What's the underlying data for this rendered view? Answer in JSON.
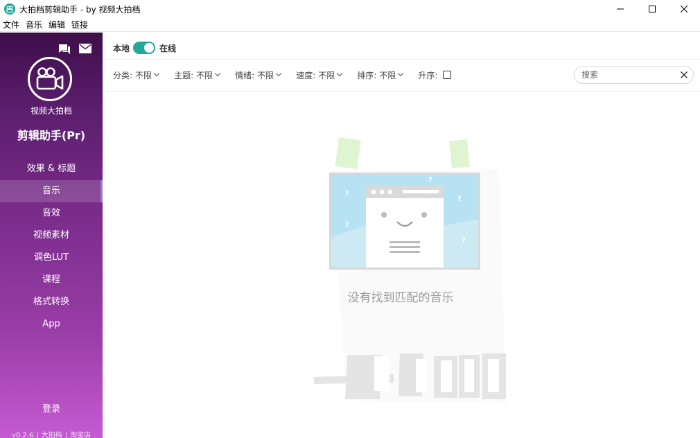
{
  "window": {
    "title": "大拍档剪辑助手 - by 视频大拍档",
    "controls": {
      "minimize_icon": "minimize-icon",
      "maximize_icon": "maximize-icon",
      "close_icon": "close-icon"
    }
  },
  "menu": [
    "文件",
    "音乐",
    "编辑",
    "链接"
  ],
  "sidebar": {
    "brand": "视频大拍档",
    "app_name": "剪辑助手(Pr)",
    "items": [
      {
        "label": "效果 & 标题",
        "active": false
      },
      {
        "label": "音乐",
        "active": true
      },
      {
        "label": "音效",
        "active": false
      },
      {
        "label": "视频素材",
        "active": false
      },
      {
        "label": "调色LUT",
        "active": false
      },
      {
        "label": "课程",
        "active": false
      },
      {
        "label": "格式转换",
        "active": false
      },
      {
        "label": "App",
        "active": false
      }
    ],
    "login": "登录",
    "footer": {
      "version": "v0.2.6",
      "sep": "|",
      "link1": "大拍档",
      "link2": "淘宝店"
    }
  },
  "main": {
    "source": {
      "local": "本地",
      "online": "在线",
      "toggle_on": true
    },
    "filters": [
      {
        "label": "分类:",
        "value": "不限"
      },
      {
        "label": "主题:",
        "value": "不限"
      },
      {
        "label": "情绪:",
        "value": "不限"
      },
      {
        "label": "速度:",
        "value": "不限"
      },
      {
        "label": "排序:",
        "value": "不限"
      }
    ],
    "ascending_label": "升序:",
    "ascending_checked": false,
    "search": {
      "placeholder": "搜索",
      "value": ""
    },
    "empty_message": "没有找到匹配的音乐"
  },
  "colors": {
    "accent": "#26a69a",
    "sidebar_top": "#3e0e49",
    "sidebar_bottom": "#c55ad2"
  }
}
